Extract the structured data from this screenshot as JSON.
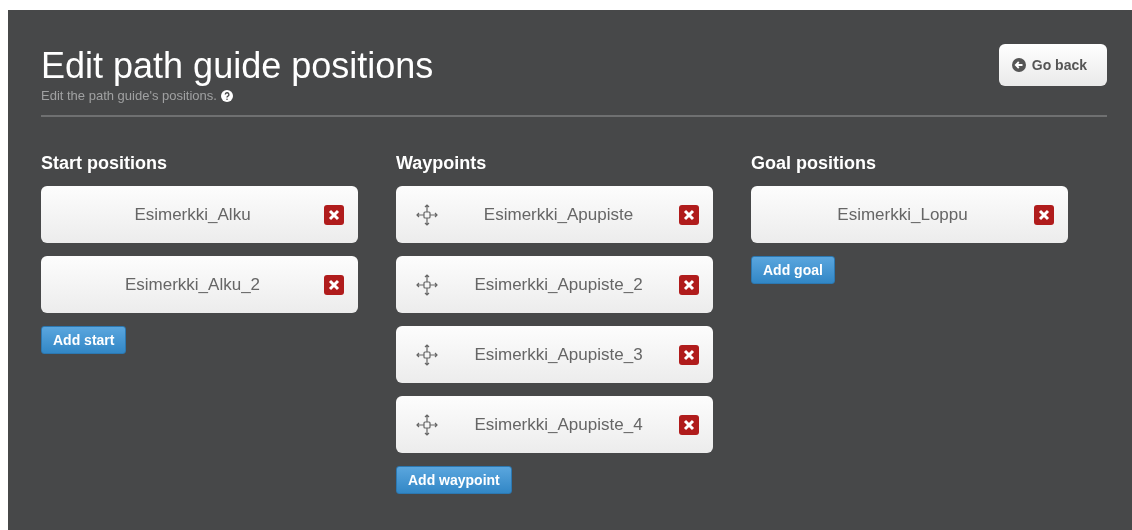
{
  "header": {
    "title": "Edit path guide positions",
    "subtitle": "Edit the path guide's positions.",
    "back_button": "Go back"
  },
  "columns": [
    {
      "title": "Start positions",
      "draggable": false,
      "items": [
        "Esimerkki_Alku",
        "Esimerkki_Alku_2"
      ],
      "add_button": "Add start"
    },
    {
      "title": "Waypoints",
      "draggable": true,
      "items": [
        "Esimerkki_Apupiste",
        "Esimerkki_Apupiste_2",
        "Esimerkki_Apupiste_3",
        "Esimerkki_Apupiste_4"
      ],
      "add_button": "Add waypoint"
    },
    {
      "title": "Goal positions",
      "draggable": false,
      "items": [
        "Esimerkki_Loppu"
      ],
      "add_button": "Add goal"
    }
  ]
}
